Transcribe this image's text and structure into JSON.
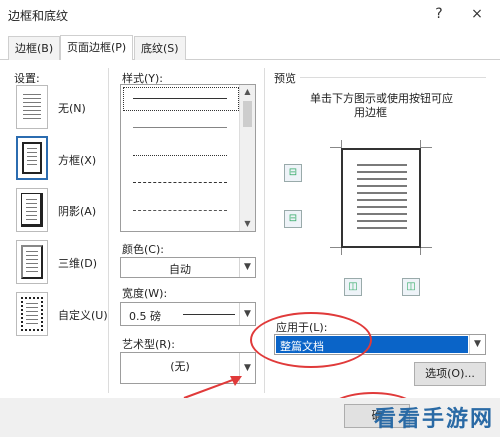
{
  "window": {
    "title": "边框和底纹",
    "help_icon": "?",
    "close_icon": "×"
  },
  "tabs": [
    {
      "label": "边框(B)"
    },
    {
      "label": "页面边框(P)"
    },
    {
      "label": "底纹(S)"
    }
  ],
  "settings": {
    "heading": "设置:",
    "items": [
      {
        "label": "无(N)"
      },
      {
        "label": "方框(X)"
      },
      {
        "label": "阴影(A)"
      },
      {
        "label": "三维(D)"
      },
      {
        "label": "自定义(U)"
      }
    ]
  },
  "style": {
    "label": "样式(Y):"
  },
  "color": {
    "label": "颜色(C):",
    "value": "自动"
  },
  "width": {
    "label": "宽度(W):",
    "value": "0.5 磅"
  },
  "art": {
    "label": "艺术型(R):",
    "value": "(无)"
  },
  "preview": {
    "label": "预览",
    "instruction_line1": "单击下方图示或使用按钮可应",
    "instruction_line2": "用边框"
  },
  "apply_to": {
    "label": "应用于(L):",
    "value": "整篇文档"
  },
  "options_button": "选项(O)...",
  "footer": {
    "ok_fragment": "确"
  },
  "watermark": "看看手游网",
  "colors": {
    "selection": "#0a64c8",
    "annotation": "#e03a3a"
  }
}
